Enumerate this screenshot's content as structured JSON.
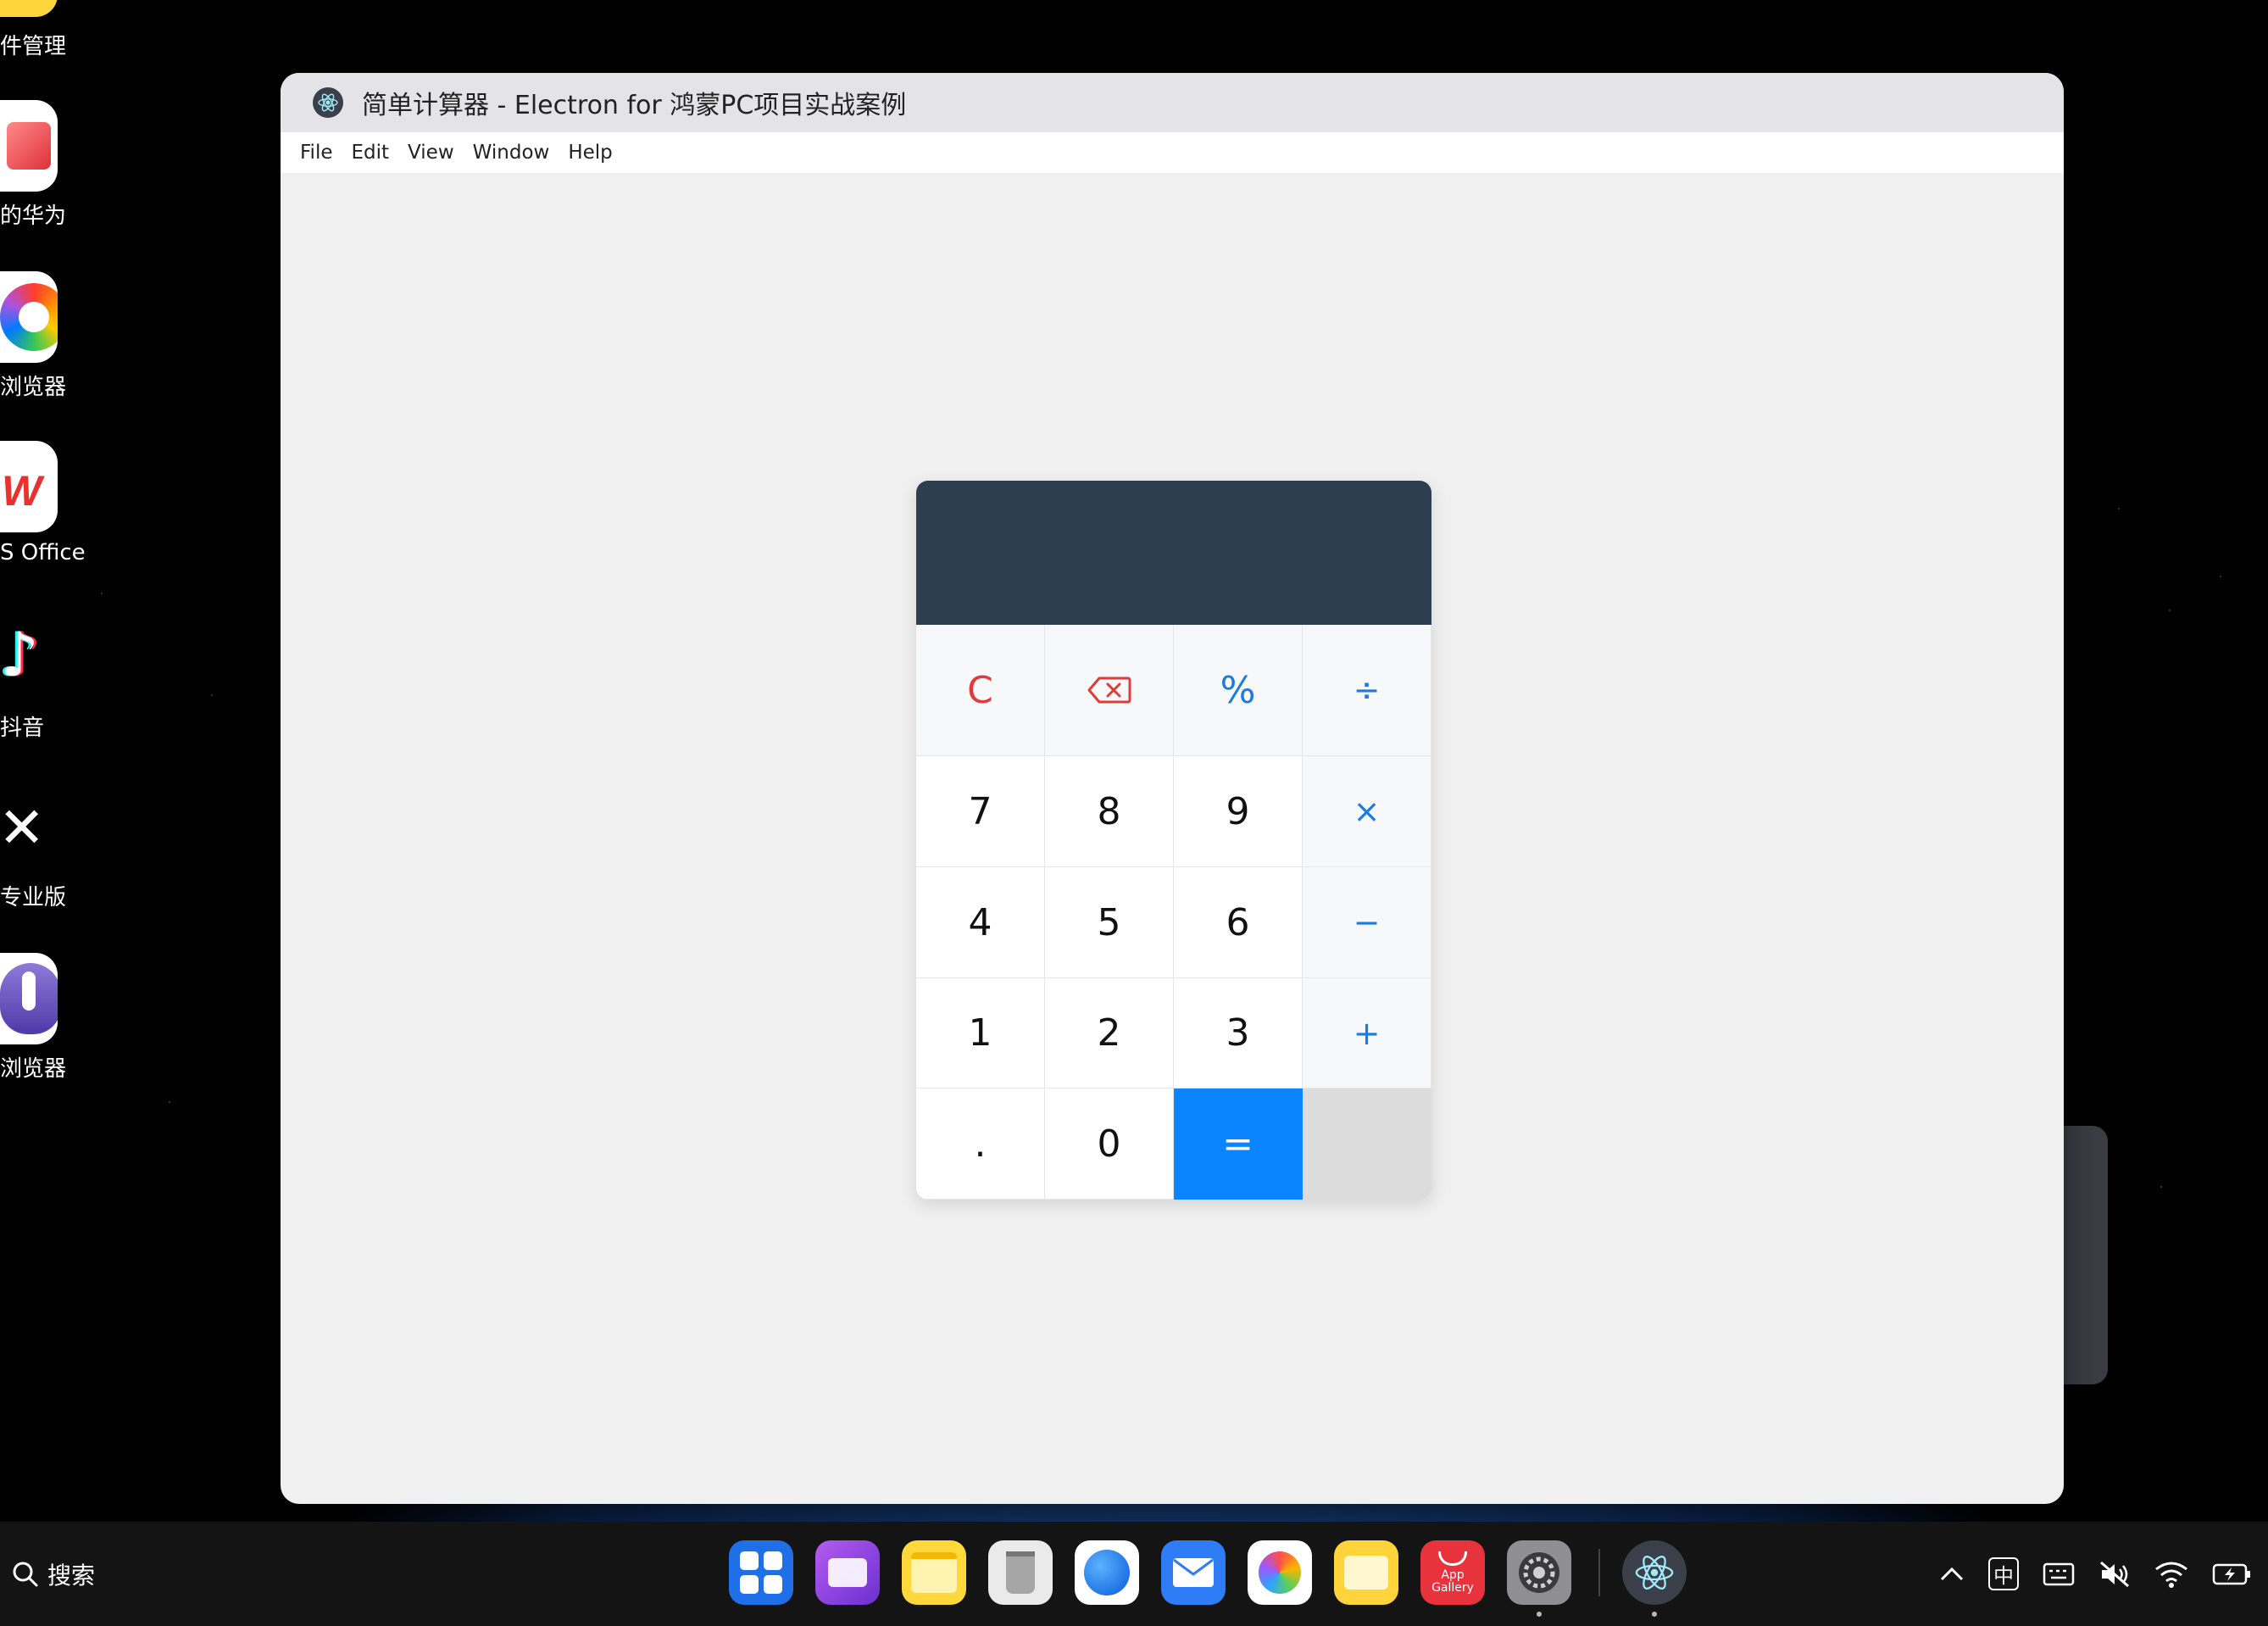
{
  "desktop": {
    "apps": [
      {
        "label": "件管理",
        "icon": "file-manager-icon"
      },
      {
        "label": "的华为",
        "icon": "my-huawei-icon"
      },
      {
        "label": "浏览器",
        "icon": "browser-icon"
      },
      {
        "label": "S Office",
        "icon": "wps-office-icon"
      },
      {
        "label": "抖音",
        "icon": "douyin-icon"
      },
      {
        "label": "专业版",
        "icon": "capcut-pro-icon"
      },
      {
        "label": "浏览器",
        "icon": "purple-browser-icon"
      }
    ]
  },
  "window": {
    "title": "简单计算器 - Electron for 鸿蒙PC项目实战案例",
    "menu": [
      "File",
      "Edit",
      "View",
      "Window",
      "Help"
    ]
  },
  "calculator": {
    "display": "",
    "keys": {
      "clear": "C",
      "percent": "%",
      "divide": "÷",
      "seven": "7",
      "eight": "8",
      "nine": "9",
      "multiply": "×",
      "four": "4",
      "five": "5",
      "six": "6",
      "minus": "−",
      "one": "1",
      "two": "2",
      "three": "3",
      "plus": "+",
      "dot": ".",
      "zero": "0",
      "equals": "="
    },
    "colors": {
      "display_bg": "#2c3e50",
      "equals_bg": "#0a84ff",
      "clear_color": "#e03b3b",
      "operator_color": "#1a7be0"
    }
  },
  "dock": {
    "search_label": "搜索",
    "app_gallery_line1": "App",
    "app_gallery_line2": "Gallery",
    "tray_ime": "中"
  }
}
